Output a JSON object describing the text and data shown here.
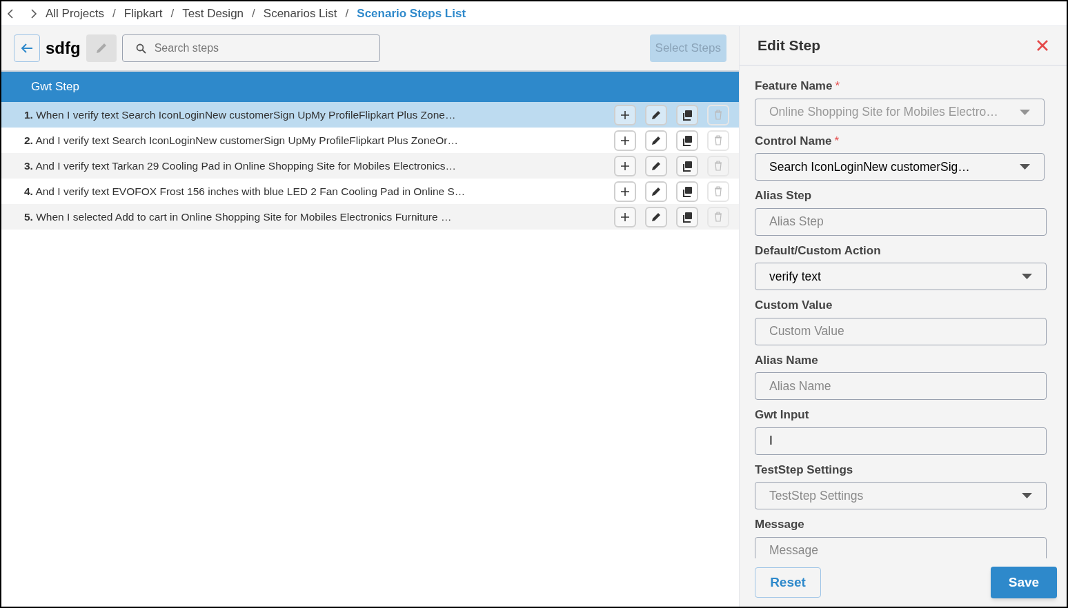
{
  "breadcrumb_separator": "/",
  "breadcrumb": [
    {
      "label": "All Projects",
      "current": false
    },
    {
      "label": "Flipkart",
      "current": false
    },
    {
      "label": "Test Design",
      "current": false
    },
    {
      "label": "Scenarios List",
      "current": false
    },
    {
      "label": "Scenario Steps List",
      "current": true
    }
  ],
  "scenario": {
    "title": "sdfg"
  },
  "search": {
    "placeholder": "Search steps"
  },
  "select_steps_button": {
    "label": "Select Steps",
    "disabled": true
  },
  "table": {
    "header": "Gwt Step",
    "rows": [
      {
        "number": "1.",
        "text": "When I verify text Search IconLoginNew customerSign UpMy ProfileFlipkart Plus Zone…",
        "selected": true
      },
      {
        "number": "2.",
        "text": "And I verify text Search IconLoginNew customerSign UpMy ProfileFlipkart Plus ZoneOr…",
        "selected": false
      },
      {
        "number": "3.",
        "text": "And I verify text Tarkan 29 Cooling Pad in Online Shopping Site for Mobiles Electronics…",
        "selected": false
      },
      {
        "number": "4.",
        "text": "And I verify text EVOFOX Frost 156 inches with blue LED 2 Fan Cooling Pad in Online S…",
        "selected": false
      },
      {
        "number": "5.",
        "text": "When I selected Add to cart in Online Shopping Site for Mobiles Electronics Furniture …",
        "selected": false
      }
    ]
  },
  "edit_panel": {
    "title": "Edit Step",
    "fields": [
      {
        "label": "Feature Name",
        "required_mark": "*",
        "kind": "select",
        "value": "Online Shopping Site for Mobiles Electro…",
        "disabled": true
      },
      {
        "label": "Control Name",
        "required_mark": "*",
        "kind": "select",
        "value": "Search IconLoginNew customerSig…",
        "disabled": false
      },
      {
        "label": "Alias Step",
        "kind": "input",
        "placeholder": "Alias Step"
      },
      {
        "label": "Default/Custom Action",
        "kind": "select",
        "value": "verify text",
        "disabled": false
      },
      {
        "label": "Custom Value",
        "kind": "input",
        "placeholder": "Custom Value"
      },
      {
        "label": "Alias Name",
        "kind": "input",
        "placeholder": "Alias Name"
      },
      {
        "label": "Gwt Input",
        "kind": "input",
        "value": "I"
      },
      {
        "label": "TestStep Settings",
        "kind": "select",
        "placeholder": "TestStep Settings",
        "disabled": false
      },
      {
        "label": "Message",
        "kind": "input",
        "placeholder": "Message"
      }
    ],
    "buttons": [
      {
        "label": "Reset",
        "kind": "outline"
      },
      {
        "label": "Save",
        "kind": "primary"
      }
    ]
  }
}
